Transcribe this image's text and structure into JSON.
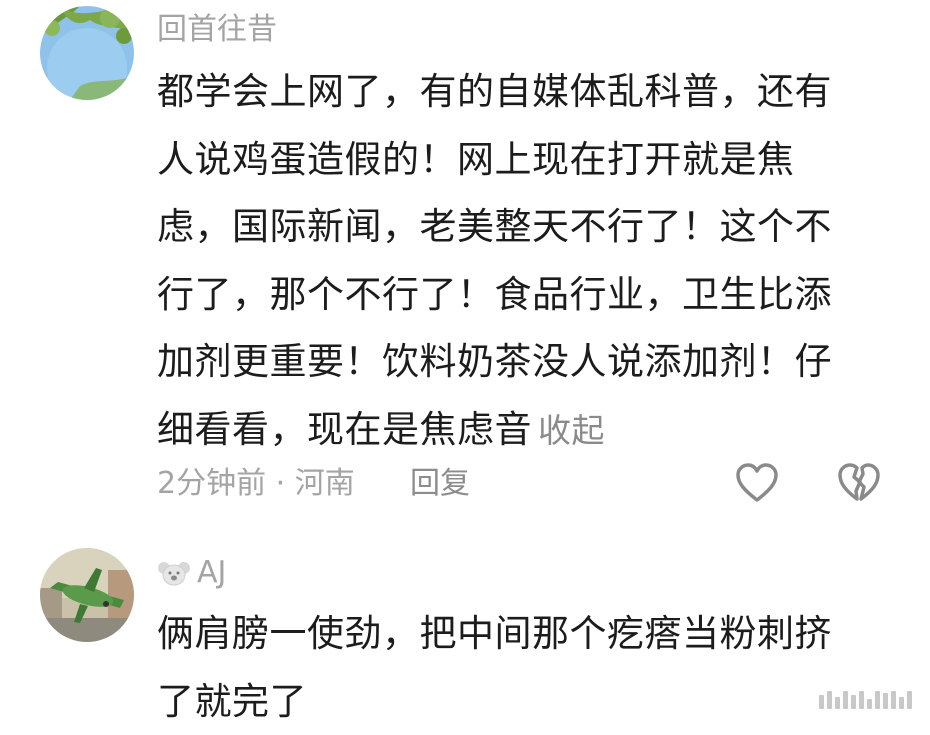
{
  "comments": [
    {
      "username": "回首往昔",
      "text_lines": [
        "都学会上网了，有的自媒体乱科普，还有",
        "人说鸡蛋造假的！网上现在打开就是焦",
        "虑，国际新闻，老美整天不行了！这个不",
        "行了，那个不行了！食品行业，卫生比添",
        "加剂更重要！饮料奶茶没人说添加剂！仔",
        "细看看，现在是焦虑音"
      ],
      "collapse_label": "收起",
      "time_location": "2分钟前 · 河南",
      "reply_label": "回复",
      "like_icon": "heart-outline-icon",
      "dislike_icon": "broken-heart-icon"
    },
    {
      "username": "AJ",
      "badge_icon": "koala-icon",
      "text_lines": [
        "俩肩膀一使劲，把中间那个疙瘩当粉刺挤",
        "了就完了"
      ]
    }
  ]
}
